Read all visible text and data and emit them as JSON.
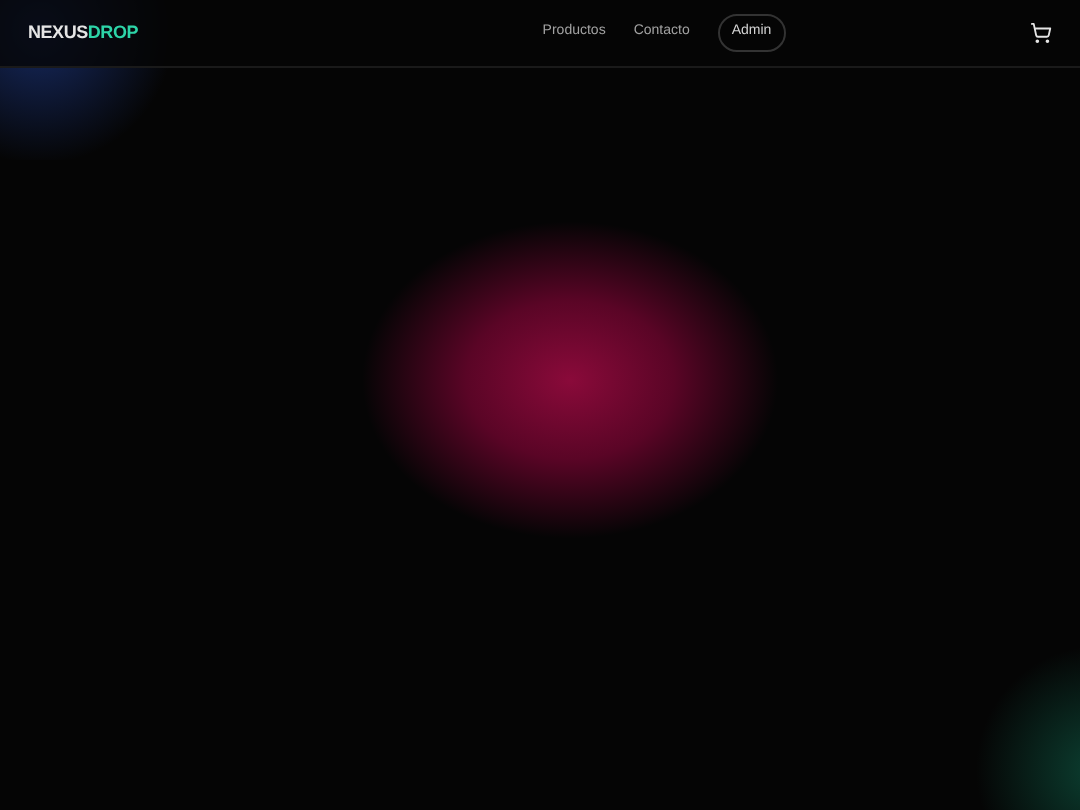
{
  "header": {
    "logo": {
      "part_1": "NEXUS",
      "part_2": "DROP"
    },
    "nav": [
      {
        "label": "Productos",
        "kind": "link"
      },
      {
        "label": "Contacto",
        "kind": "link"
      },
      {
        "label": "Admin",
        "kind": "pill"
      }
    ]
  }
}
